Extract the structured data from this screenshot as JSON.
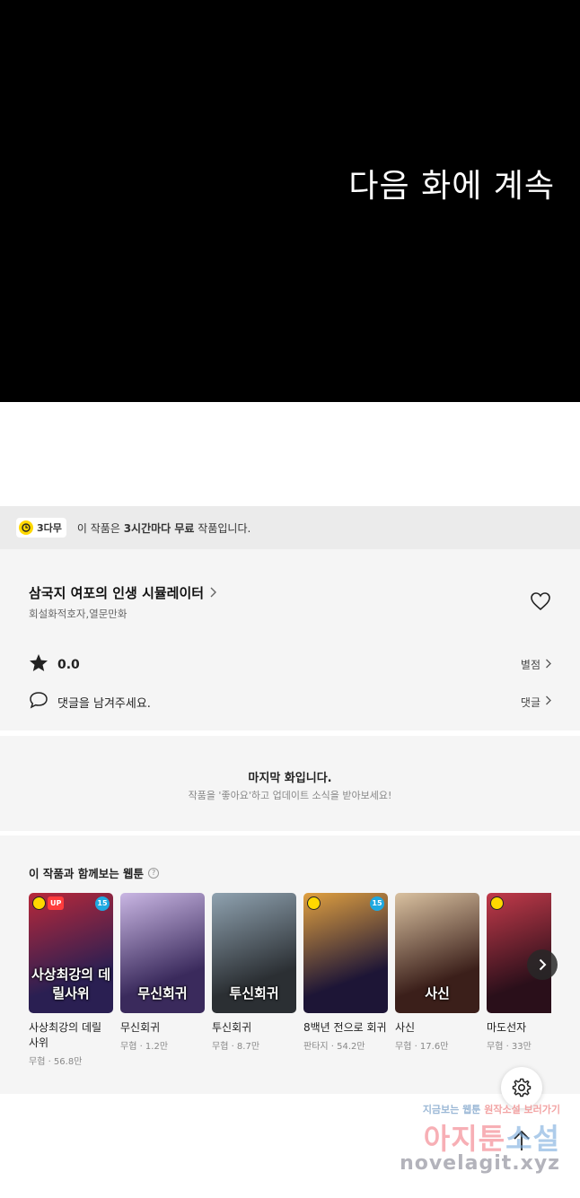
{
  "hero": {
    "text": "다음 화에 계속"
  },
  "free_banner": {
    "badge": "3다무",
    "text_prefix": "이 작품은 ",
    "text_bold": "3시간마다 무료",
    "text_suffix": " 작품입니다."
  },
  "series": {
    "title": "삼국지 여포의 인생 시뮬레이터",
    "genre": "회설화적호자,열문만화",
    "rating": "0.0",
    "rating_link": "별점",
    "comment_placeholder": "댓글을 남겨주세요.",
    "comment_link": "댓글"
  },
  "last_episode": {
    "title": "마지막 화입니다.",
    "subtitle": "작품을 '좋아요'하고 업데이트 소식을 받아보세요!"
  },
  "recommend": {
    "title": "이 작품과 함께보는 웹툰",
    "cards": [
      {
        "name": "사상최강의 데릴 사위",
        "meta": "무협 · 56.8만",
        "art": "사상최강의 데릴사위",
        "up": "UP",
        "age": "15",
        "colors": [
          "#2a1f52",
          "#b8283a"
        ]
      },
      {
        "name": "무신회귀",
        "meta": "무협 · 1.2만",
        "art": "무신회귀",
        "colors": [
          "#3a2a5c",
          "#c9b6e3"
        ]
      },
      {
        "name": "투신회귀",
        "meta": "무협 · 8.7만",
        "art": "투신회귀",
        "colors": [
          "#2b2f33",
          "#8fa2b0"
        ]
      },
      {
        "name": "8백년 전으로 회귀",
        "meta": "판타지 · 54.2만",
        "art": "",
        "age": "15",
        "colors": [
          "#1d1536",
          "#e0a040"
        ]
      },
      {
        "name": "사신",
        "meta": "무협 · 17.6만",
        "art": "사신",
        "colors": [
          "#3b1f1a",
          "#d9c1a0"
        ]
      },
      {
        "name": "마도선자",
        "meta": "무협 · 33만",
        "art": "",
        "colors": [
          "#2a0f1a",
          "#c23a4a"
        ]
      }
    ]
  },
  "watermark": {
    "line1_a": "지금보는 웹툰 ",
    "line1_b": "원작소설 보러가기",
    "line2_a": "아지툰",
    "line2_b": "소설",
    "line3": "novelagit.xyz"
  }
}
